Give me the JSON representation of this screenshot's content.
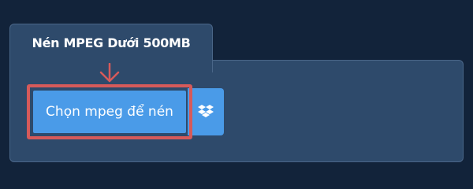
{
  "tab": {
    "title": "Nén MPEG Dưới 500MB"
  },
  "actions": {
    "choose_label": "Chọn mpeg để nén",
    "dropbox_icon": "dropbox-icon",
    "arrow_icon": "arrow-down-icon"
  },
  "colors": {
    "background": "#12233a",
    "panel": "#2e4a6b",
    "button": "#4a9be8",
    "highlight": "#d65a5a"
  }
}
